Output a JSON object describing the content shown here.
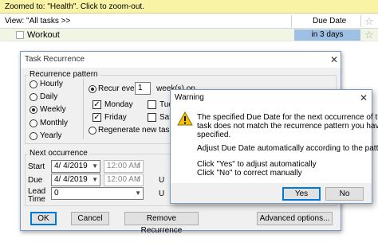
{
  "zoom_bar": {
    "text": "Zoomed to: \"Health\". Click to zoom-out."
  },
  "column_header": {
    "view": "View: \"All tasks >>",
    "due_date": "Due Date"
  },
  "task_row": {
    "title": "Workout",
    "due": "in 3 days"
  },
  "recurrence_dialog": {
    "title": "Task Recurrence",
    "pattern_group": "Recurrence pattern",
    "frequency_options": [
      {
        "label": "Hourly",
        "selected": false
      },
      {
        "label": "Daily",
        "selected": false
      },
      {
        "label": "Weekly",
        "selected": true
      },
      {
        "label": "Monthly",
        "selected": false
      },
      {
        "label": "Yearly",
        "selected": false
      }
    ],
    "recur_every_label": "Recur every",
    "recur_every_value": "1",
    "weeks_on_label": "week(s) on",
    "days": [
      {
        "label": "Monday",
        "checked": true
      },
      {
        "label": "Tue",
        "checked": false
      },
      {
        "label": "Friday",
        "checked": true
      },
      {
        "label": "Sat",
        "checked": false
      }
    ],
    "regenerate_label": "Regenerate new task",
    "next_group": "Next occurrence",
    "start_label": "Start",
    "start_date": "4/  4/2019",
    "start_time": "12:00 AM",
    "due_label": "Due",
    "due_date": "4/  4/2019",
    "due_time": "12:00 AM",
    "lead_label_1": "Lead",
    "lead_label_2": "Time",
    "lead_value": "0",
    "trunc_u1": "U",
    "trunc_u2": "U",
    "ok": "OK",
    "cancel": "Cancel",
    "remove": "Remove Recurrence",
    "advanced": "Advanced options..."
  },
  "warning_dialog": {
    "title": "Warning",
    "line1": "The specified Due Date for the next occurrence of this",
    "line2": "task does not match the recurrence pattern you have",
    "line3": "specified.",
    "line4": "Adjust Due Date automatically according to the pattern?",
    "line5": "Click \"Yes\" to adjust automatically",
    "line6": "Click \"No\" to correct manually",
    "yes": "Yes",
    "no": "No"
  },
  "colors": {
    "zoom_bar": "#f9f3a6",
    "due_highlight": "#9ec0e4",
    "task_row": "#f1f6e4",
    "warning_icon": "#f2c200"
  }
}
